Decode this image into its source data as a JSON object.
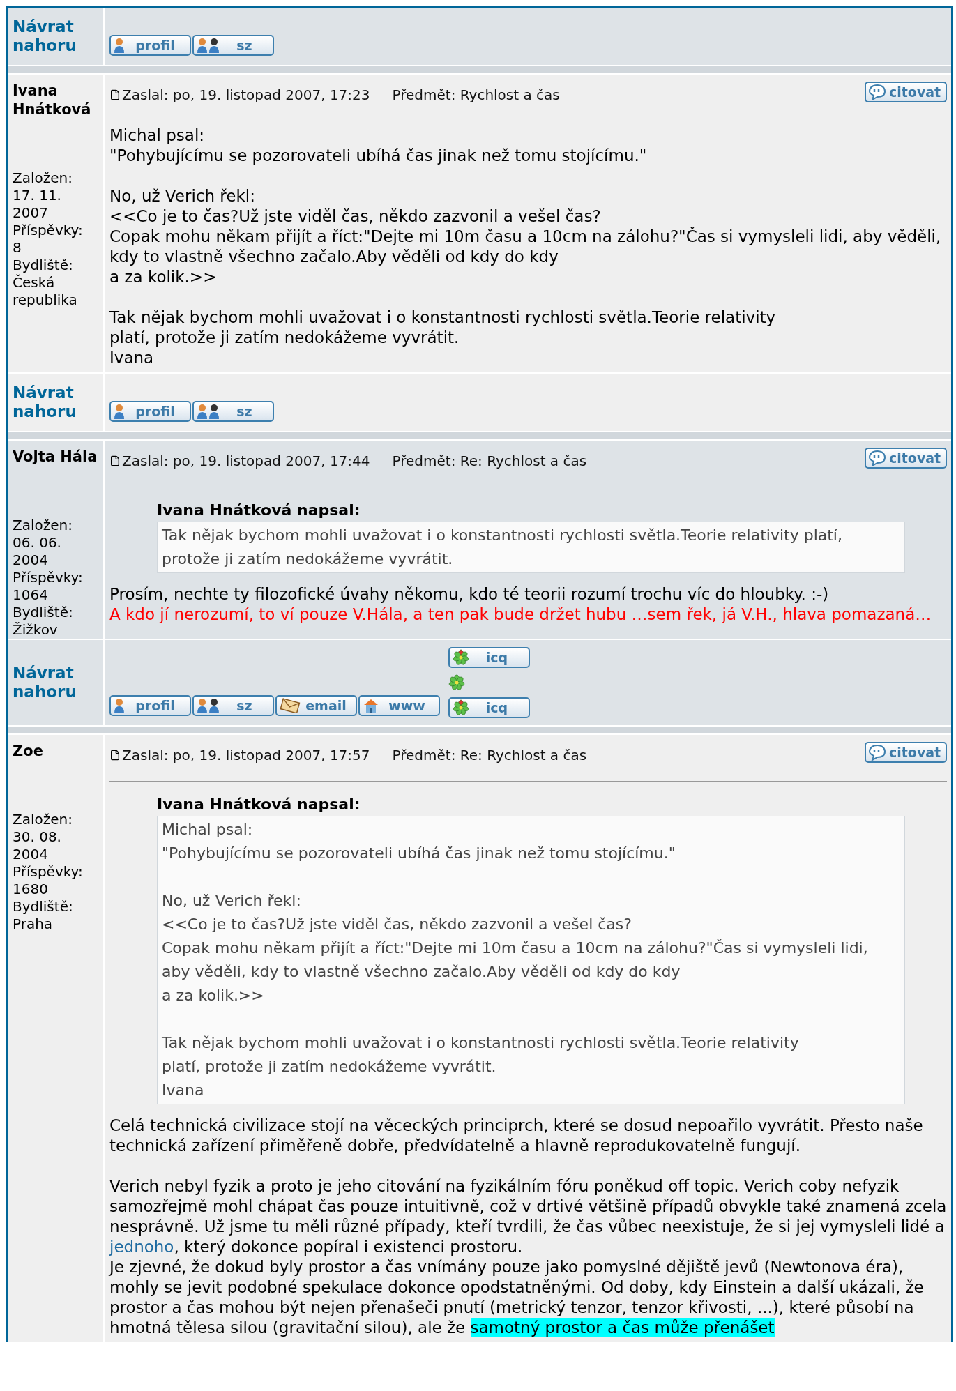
{
  "top_row": {
    "back_link": "Návrat nahoru",
    "buttons": [
      {
        "kind": "profile",
        "label": "profil"
      },
      {
        "kind": "pm",
        "label": "sz"
      }
    ]
  },
  "posts": [
    {
      "author": "Ivana Hnátková",
      "details": [
        {
          "label": "Založen:",
          "value": "17. 11. 2007"
        },
        {
          "label": "Příspěvky:",
          "value": "8"
        },
        {
          "label": "Bydliště:",
          "value": "Česká republika"
        }
      ],
      "posted": "Zaslal: po, 19. listopad 2007, 17:23",
      "subject": "Předmět: Rychlost a čas",
      "quote_button": "citovat",
      "body": [
        {
          "kind": "text",
          "text": "Michal psal:\n\"Pohybujícímu se pozorovateli ubíhá čas jinak než tomu stojícímu.\"\n\nNo, už Verich řekl:\n<<Co je to čas?Už jste viděl čas, někdo zazvonil a vešel čas?\nCopak mohu někam přijít a říct:\"Dejte mi 10m času a 10cm na zálohu?\"Čas si vymysleli lidi, aby věděli, kdy to vlastně všechno začalo.Aby věděli od kdy do kdy\na za kolik.>>\n\nTak nějak bychom mohli uvažovat i o konstantnosti rychlosti světla.Teorie relativity\nplatí, protože ji zatím nedokážeme vyvrátit.\nIvana"
        }
      ],
      "back_link": "Návrat nahoru",
      "buttons": [
        {
          "kind": "profile",
          "label": "profil"
        },
        {
          "kind": "pm",
          "label": "sz"
        }
      ]
    },
    {
      "author": "Vojta Hála",
      "details": [
        {
          "label": "Založen:",
          "value": "06. 06. 2004"
        },
        {
          "label": "Příspěvky:",
          "value": "1064"
        },
        {
          "label": "Bydliště:",
          "value": "Žižkov"
        }
      ],
      "posted": "Zaslal: po, 19. listopad 2007, 17:44",
      "subject": "Předmět: Re: Rychlost a čas",
      "quote_button": "citovat",
      "quote": {
        "author": "Ivana Hnátková napsal:",
        "text": "Tak nějak bychom mohli uvažovat i o konstantnosti rychlosti světla.Teorie relativity platí, protože ji zatím nedokážeme vyvrátit."
      },
      "body": [
        {
          "kind": "text",
          "text": "Prosím, nechte ty filozofické úvahy někomu, kdo té teorii rozumí trochu víc do hloubky. :-)"
        },
        {
          "kind": "signature",
          "text": "A kdo jí nerozumí, to ví pouze V.Hála, a ten pak bude držet hubu …sem řek, já V.H., hlava pomazaná…"
        }
      ],
      "back_link": "Návrat nahoru",
      "buttons": [
        {
          "kind": "profile",
          "label": "profil"
        },
        {
          "kind": "pm",
          "label": "sz"
        },
        {
          "kind": "email",
          "label": "email"
        },
        {
          "kind": "www",
          "label": "www"
        }
      ],
      "extras": [
        {
          "kind": "icq",
          "label": "icq"
        },
        {
          "kind": "status"
        },
        {
          "kind": "icq",
          "label": "icq"
        }
      ]
    },
    {
      "author": "Zoe",
      "details": [
        {
          "label": "Založen:",
          "value": "30. 08. 2004"
        },
        {
          "label": "Příspěvky:",
          "value": "1680"
        },
        {
          "label": "Bydliště:",
          "value": "Praha"
        }
      ],
      "posted": "Zaslal: po, 19. listopad 2007, 17:57",
      "subject": "Předmět: Re: Rychlost a čas",
      "quote_button": "citovat",
      "quote": {
        "author": "Ivana Hnátková napsal:",
        "text": "Michal psal:\n\"Pohybujícímu se pozorovateli ubíhá čas jinak než tomu stojícímu.\"\n\nNo, už Verich řekl:\n<<Co je to čas?Už jste viděl čas, někdo zazvonil a vešel čas?\nCopak mohu někam přijít a říct:\"Dejte mi 10m času a 10cm na zálohu?\"Čas si vymysleli lidi, aby věděli, kdy to vlastně všechno začalo.Aby věděli od kdy do kdy\na za kolik.>>\n\nTak nějak bychom mohli uvažovat i o konstantnosti rychlosti světla.Teorie relativity\nplatí, protože ji zatím nedokážeme vyvrátit.\nIvana"
      },
      "body": [
        {
          "kind": "paragraph",
          "parts": [
            {
              "kind": "plain",
              "text": "Celá technická civilizace stojí na věceckých principrch, které se dosud nepoařilo vyvrátit. Přesto naše technická zařízení přiměřeně dobře, předvídatelně a hlavně reprodukovatelně fungují.\n\nVerich nebyl fyzik a proto je jeho citování na fyzikálním fóru poněkud off topic. Verich coby nefyzik samozřejmě mohl chápat čas pouze intuitivně, což v drtivé většině případů obvykle také znamená zcela nesprávně. Už jsme tu měli různé případy, kteří tvrdili, že čas vůbec neexistuje, že si jej vymysleli lidé a "
            },
            {
              "kind": "link",
              "text": "jednoho"
            },
            {
              "kind": "plain",
              "text": ", který dokonce popíral i existenci prostoru.\nJe zjevné, že dokud byly prostor a čas vnímány pouze jako pomyslné dějiště jevů (Newtonova éra), mohly se jevit podobné spekulace dokonce opodstatněnými. Od doby, kdy Einstein a další ukázali, že prostor a čas mohou být nejen přenašeči pnutí (metrický tenzor, tenzor křivosti, ...), které působí na hmotná tělesa silou (gravitační silou), ale že "
            },
            {
              "kind": "highlight",
              "text": "samotný prostor a čas může přenášet"
            }
          ]
        }
      ]
    }
  ]
}
